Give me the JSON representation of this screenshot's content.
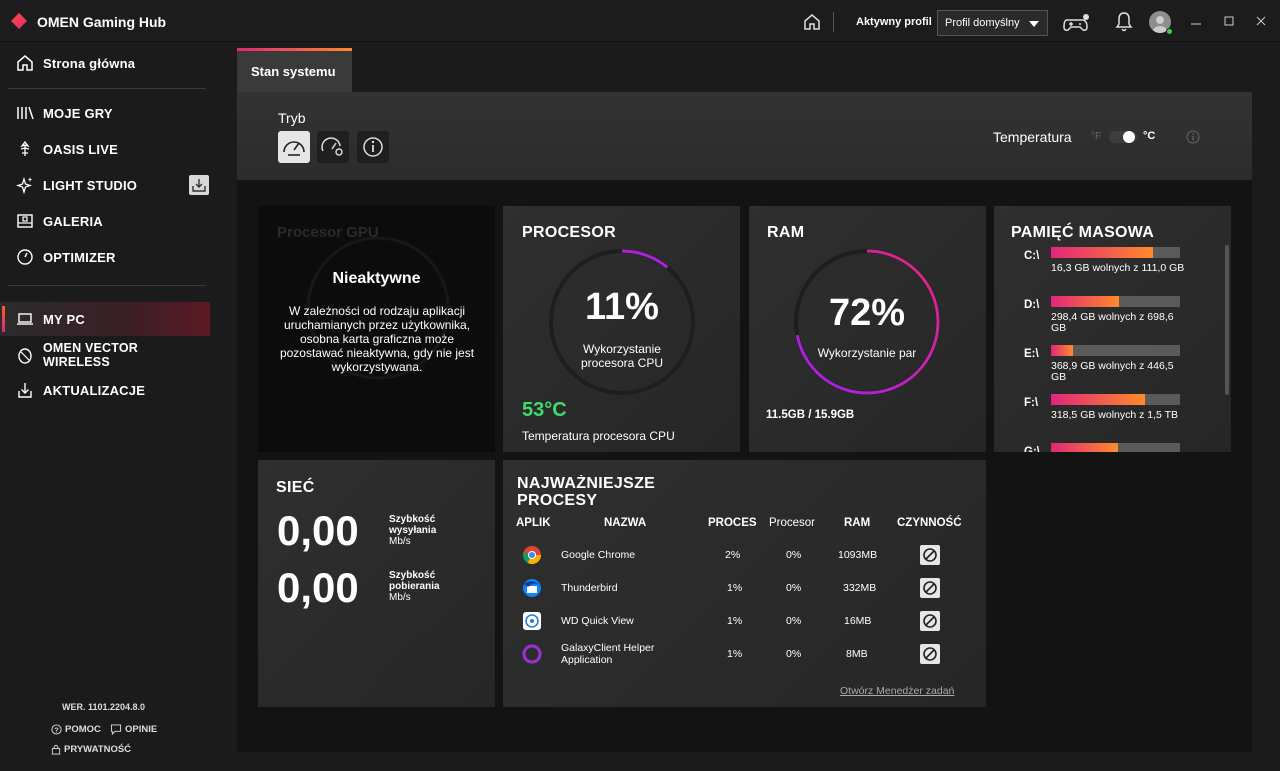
{
  "app": {
    "title": "OMEN Gaming Hub",
    "active_profile_label": "Aktywny profil",
    "profile_value": "Profil domyślny"
  },
  "sidebar": {
    "items": [
      {
        "label": "Strona główna",
        "icon": "home-icon"
      },
      {
        "label": "MOJE GRY",
        "icon": "library-icon"
      },
      {
        "label": "OASIS LIVE",
        "icon": "oasis-icon"
      },
      {
        "label": "LIGHT STUDIO",
        "icon": "sparkle-icon"
      },
      {
        "label": "GALERIA",
        "icon": "gallery-icon"
      },
      {
        "label": "OPTIMIZER",
        "icon": "gauge-icon"
      },
      {
        "label": "MY PC",
        "icon": "laptop-icon"
      },
      {
        "label": "OMEN VECTOR WIRELESS",
        "icon": "mouse-icon"
      },
      {
        "label": "AKTUALIZACJE",
        "icon": "update-icon"
      }
    ],
    "version": "WER. 1101.2204.8.0",
    "help": "POMOC",
    "feedback": "OPINIE",
    "privacy": "PRYWATNOŚĆ"
  },
  "tabs": [
    {
      "label": "Stan systemu",
      "active": true
    }
  ],
  "mode": {
    "label": "Tryb",
    "temperature_label": "Temperatura",
    "unit_f": "°F",
    "unit_c": "°C",
    "selected_unit": "°C"
  },
  "gpu": {
    "title": "Procesor GPU",
    "status": "Nieaktywne",
    "description": "W zależności od rodzaju aplikacji uruchamianych przez użytkownika, osobna karta graficzna może pozostawać nieaktywna, gdy nie jest wykorzystywana."
  },
  "cpu": {
    "title": "PROCESOR",
    "usage_pct": "11%",
    "usage_fraction": 0.11,
    "usage_label": "Wykorzystanie procesora CPU",
    "temp": "53°C",
    "temp_label": "Temperatura procesora CPU",
    "temp_color": "#3ddc6a"
  },
  "ram": {
    "title": "RAM",
    "usage_pct": "72%",
    "usage_fraction": 0.72,
    "usage_label": "Wykorzystanie par",
    "amount": "11.5GB / 15.9GB"
  },
  "storage": {
    "title": "PAMIĘĆ MASOWA",
    "drives": [
      {
        "name": "C:\\",
        "text": "16,3 GB wolnych z 111,0 GB",
        "used_fraction": 0.79
      },
      {
        "name": "D:\\",
        "text": "298,4 GB wolnych z 698,6 GB",
        "used_fraction": 0.53
      },
      {
        "name": "E:\\",
        "text": "368,9 GB wolnych z 446,5 GB",
        "used_fraction": 0.17
      },
      {
        "name": "F:\\",
        "text": "318,5 GB wolnych z 1,5 TB",
        "used_fraction": 0.73
      },
      {
        "name": "G:\\",
        "text": "",
        "used_fraction": 0.52
      }
    ]
  },
  "network": {
    "title": "SIEĆ",
    "upload_value": "0,00",
    "upload_label_1": "Szybkość",
    "upload_label_2": "wysyłania",
    "upload_unit": "Mb/s",
    "download_value": "0,00",
    "download_label_1": "Szybkość",
    "download_label_2": "pobierania",
    "download_unit": "Mb/s"
  },
  "processes": {
    "title": "NAJWAŻNIEJSZE PROCESY",
    "headers": [
      "APLIK",
      "NAZWA",
      "PROCES",
      "Procesor",
      "RAM",
      "CZYNNOŚĆ"
    ],
    "rows": [
      {
        "icon": "chrome-icon",
        "name": "Google Chrome",
        "proc": "2%",
        "cpu": "0%",
        "ram": "1093MB"
      },
      {
        "icon": "thunderbird-icon",
        "name": "Thunderbird",
        "proc": "1%",
        "cpu": "0%",
        "ram": "332MB"
      },
      {
        "icon": "wd-icon",
        "name": "WD Quick View",
        "proc": "1%",
        "cpu": "0%",
        "ram": "16MB"
      },
      {
        "icon": "galaxy-icon",
        "name": "GalaxyClient Helper Application",
        "proc": "1%",
        "cpu": "0%",
        "ram": "8MB"
      }
    ],
    "task_manager_link": "Otwórz Menedżer zadań"
  },
  "colors": {
    "accent_pink": "#e0267b",
    "accent_orange": "#ff8a2a",
    "accent_purple": "#a020f0",
    "cpu_temp_green": "#3ddc6a"
  }
}
